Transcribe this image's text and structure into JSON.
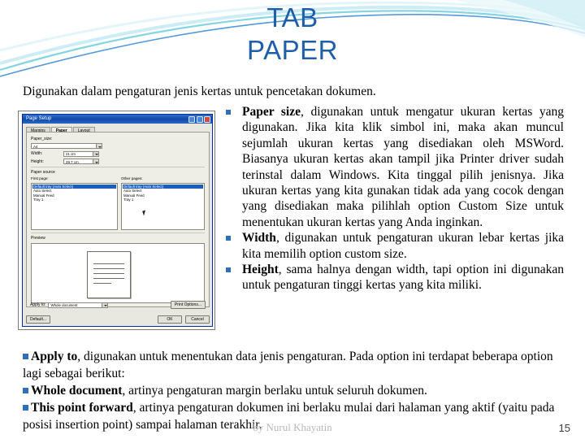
{
  "title": {
    "line1": "TAB",
    "line2": "PAPER"
  },
  "intro": "Digunakan dalam pengaturan jenis kertas untuk pencetakan dokumen.",
  "bullets": [
    {
      "bold": "Paper size",
      "text": ", digunakan untuk mengatur ukuran kertas yang digunakan. Jika kita klik simbol ini, maka akan muncul sejumlah ukuran kertas yang disediakan oleh MSWord. Biasanya ukuran kertas akan tampil jika Printer driver sudah terinstal dalam Windows. Kita tinggal pilih jenisnya. Jika ukuran kertas yang kita gunakan tidak ada yang cocok dengan yang disediakan maka pilihlah option Custom Size untuk menentukan ukuran kertas yang Anda inginkan."
    },
    {
      "bold": "Width",
      "text": ", digunakan untuk pengaturan ukuran lebar kertas jika kita memilih option custom size."
    },
    {
      "bold": "Height",
      "text": ", sama halnya dengan width, tapi option ini digunakan untuk pengaturan tinggi kertas yang kita miliki."
    }
  ],
  "bottom": [
    {
      "bold": "Apply to",
      "text": ", digunakan untuk menentukan data jenis pengaturan. Pada option ini terdapat beberapa option  lagi sebagai berikut:"
    },
    {
      "bold": "Whole document",
      "text": ", artinya pengaturan margin berlaku untuk seluruh dokumen."
    },
    {
      "bold": "This point forward",
      "text": ", artinya pengaturan dokumen ini berlaku mulai dari halaman yang aktif (yaitu pada posisi insertion point) sampai halaman terakhir."
    }
  ],
  "footer": {
    "credit": "by Nurul Khayatin",
    "page_number": "15"
  },
  "dialog": {
    "window_title": "Page Setup",
    "tabs": [
      "Margins",
      "Paper",
      "Layout"
    ],
    "active_tab": "Paper",
    "paper_size_label": "Paper_size:",
    "paper_size_value": "A4",
    "width_label": "Width:",
    "width_value": "21 cm",
    "height_label": "Height:",
    "height_value": "29.7 cm",
    "paper_source_label": "Paper source",
    "first_page_label": "First page:",
    "other_pages_label": "Other pages:",
    "source_left": [
      "Default tray (Auto Select)",
      "Auto Select",
      "Manual Feed",
      "Tray 1"
    ],
    "source_right": [
      "Default tray (Auto Select)",
      "Auto Select",
      "Manual Feed",
      "Tray 1"
    ],
    "preview_label": "Preview",
    "apply_to_label": "Apply to:",
    "apply_to_value": "Whole document",
    "print_options_button": "Print Options...",
    "default_button": "Default...",
    "ok_button": "OK",
    "cancel_button": "Cancel"
  },
  "colors": {
    "title_blue": "#1f5faa",
    "bullet_blue": "#2d6fbb",
    "deco_teal": "#5fc8d8",
    "deco_blue": "#2f6fd0"
  }
}
